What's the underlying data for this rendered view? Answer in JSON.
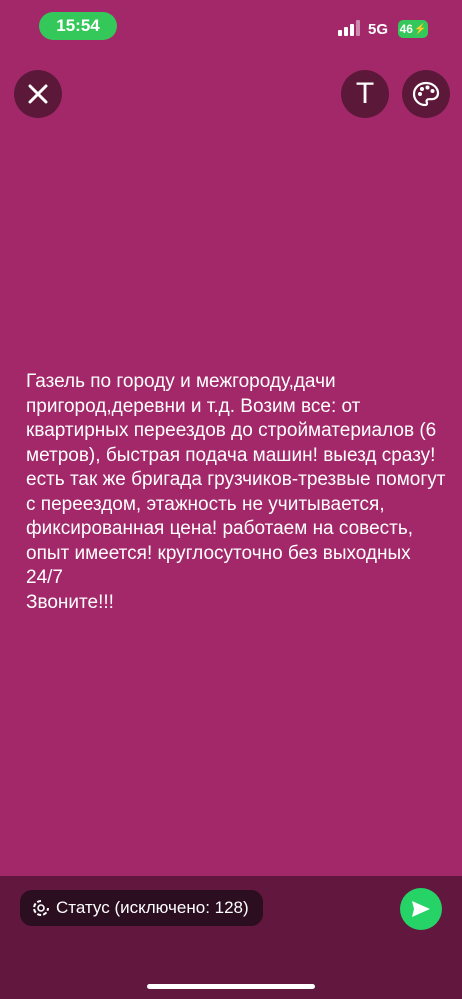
{
  "status_bar": {
    "time": "15:54",
    "network": "5G",
    "battery": "46"
  },
  "toolbar": {
    "close_icon": "close-icon",
    "text_label": "T",
    "palette_icon": "palette-icon"
  },
  "status_message": {
    "text": "Газель по городу и межгороду,дачи пригород,деревни и т.д. Возим все: от квартирных переездов до стройматериалов (6 метров), быстрая подача машин! выезд сразу! есть так же бригада грузчиков-трезвые помогут с переездом, этажность не учитывается, фиксированная цена! работаем на совесть, опыт имеется! круглосуточно без выходных 24/7\nЗвоните!!!",
    "background_color": "#a3286a"
  },
  "bottom_bar": {
    "status_chip_label": "Статус (исключено: 128)",
    "send_icon": "send-icon"
  }
}
